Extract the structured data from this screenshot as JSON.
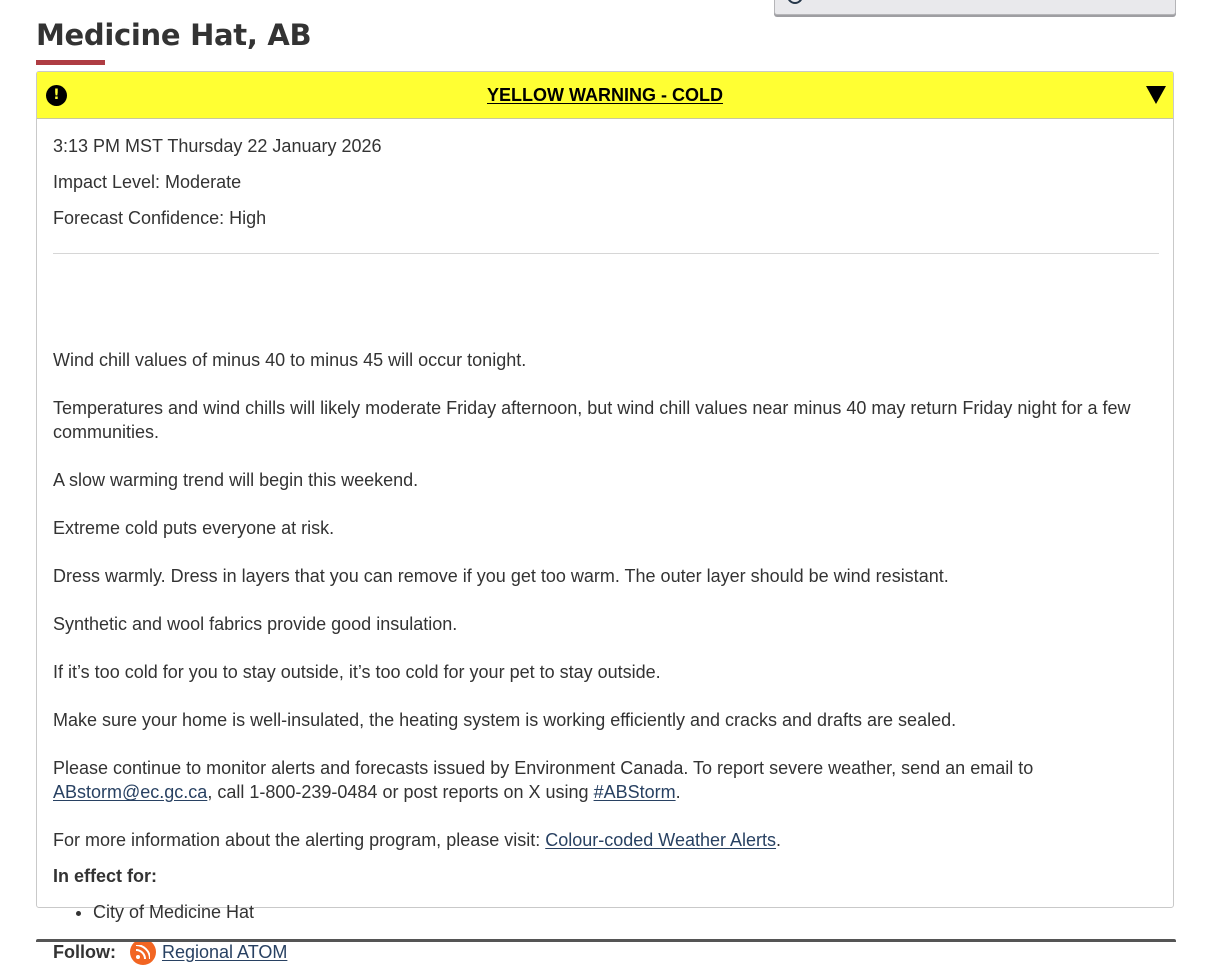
{
  "page": {
    "title": "Medicine Hat, AB"
  },
  "alert": {
    "heading": "YELLOW WARNING - COLD",
    "colors": {
      "banner": "#ffff33",
      "accent": "#af3c43",
      "link": "#284162"
    },
    "issued": "3:13 PM MST Thursday 22 January 2026",
    "impact": "Impact Level: Moderate",
    "confidence": "Forecast Confidence: High",
    "paragraphs": [
      "Wind chill values of minus 40 to minus 45 will occur tonight.",
      "Temperatures and wind chills will likely moderate Friday afternoon, but wind chill values near minus 40 may return Friday night for a few communities.",
      "A slow warming trend will begin this weekend.",
      "Extreme cold puts everyone at risk.",
      "Dress warmly. Dress in layers that you can remove if you get too warm. The outer layer should be wind resistant.",
      "Synthetic and wool fabrics provide good insulation.",
      "If it’s too cold for you to stay outside, it’s too cold for your pet to stay outside.",
      "Make sure your home is well-insulated, the heating system is working efficiently and cracks and drafts are sealed."
    ],
    "report": {
      "text1": "Please continue to monitor alerts and forecasts issued by Environment Canada. To report severe weather, send an email to ",
      "email": "ABstorm@ec.gc.ca",
      "text2": ", call 1-800-239-0484 or post reports on X using ",
      "hashtag": "#ABStorm",
      "text3": "."
    },
    "more_info": {
      "text": "For more information about the alerting program, please visit: ",
      "link": "Colour-coded Weather Alerts",
      "end": "."
    },
    "in_effect_label": "In effect for:",
    "areas": [
      "City of Medicine Hat"
    ],
    "follow_label": "Follow:",
    "follow_link": "Regional ATOM"
  },
  "icons": {
    "warning": "exclamation-circle-icon",
    "toggle": "caret-down-icon",
    "feed": "rss-icon"
  }
}
